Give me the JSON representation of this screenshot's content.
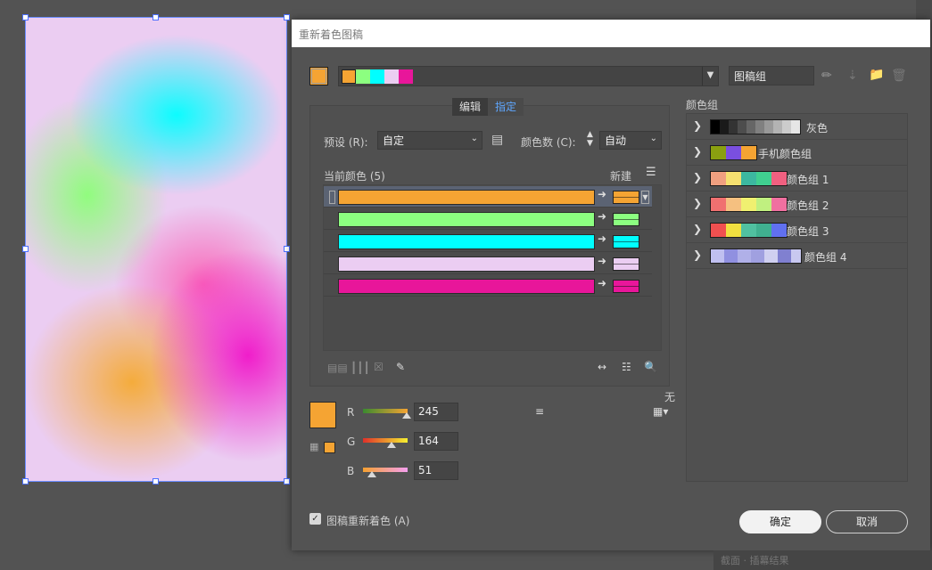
{
  "dialog": {
    "title": "重新着色图稿",
    "group_name": "图稿组",
    "tabs": [
      {
        "label": "编辑",
        "active": false
      },
      {
        "label": "指定",
        "active": true
      }
    ],
    "preset_label": "预设 (R):",
    "preset_value": "自定",
    "colors_label": "颜色数 (C):",
    "colors_value": "自动",
    "current_colors_label": "当前颜色 (5)",
    "new_label": "新建",
    "none_label": "无",
    "recolor_label": "图稿重新着色 (A)",
    "ok_label": "确定",
    "cancel_label": "取消"
  },
  "palette": [
    "#f5a433",
    "#8cff80",
    "#00ffff",
    "#ebcdf2",
    "#e8169a"
  ],
  "current_colors": [
    {
      "current": "#f5a433",
      "new": "#f5a433",
      "selected": true
    },
    {
      "current": "#8cff80",
      "new": "#8cff80",
      "selected": false
    },
    {
      "current": "#00ffff",
      "new": "#00ffff",
      "selected": false
    },
    {
      "current": "#ebcdf2",
      "new": "#ebcdf2",
      "selected": false
    },
    {
      "current": "#e8169a",
      "new": "#e8169a",
      "selected": false
    }
  ],
  "rgb": {
    "r_label": "R",
    "r_value": "245",
    "g_label": "G",
    "g_value": "164",
    "b_label": "B",
    "b_value": "51"
  },
  "color_groups": {
    "title": "颜色组",
    "groups": [
      {
        "name": "灰色",
        "swatches": [
          "#000000",
          "#1a1a1a",
          "#333333",
          "#4d4d4d",
          "#666666",
          "#808080",
          "#999999",
          "#b3b3b3",
          "#cccccc",
          "#e6e6e6"
        ]
      },
      {
        "name": "手机颜色组",
        "swatches": [
          "#8aa010",
          "#7a4fe0",
          "#f5a433"
        ]
      },
      {
        "name": "颜色组 1",
        "swatches": [
          "#f0a080",
          "#f5e070",
          "#3cb8a0",
          "#40d090",
          "#f06080"
        ]
      },
      {
        "name": "颜色组 2",
        "swatches": [
          "#f07070",
          "#f5c080",
          "#f0f070",
          "#c0f080",
          "#f070a0"
        ]
      },
      {
        "name": "颜色组 3",
        "swatches": [
          "#f05050",
          "#f0e040",
          "#50c0a0",
          "#40b090",
          "#6070f0"
        ]
      },
      {
        "name": "颜色组 4",
        "swatches": [
          "#c0c0f0",
          "#9090e0",
          "#b0b0e8",
          "#a0a0e0",
          "#d0d0f0",
          "#8080d0",
          "#c8c8f0"
        ]
      }
    ]
  },
  "bottom_strip_text": "截面 · 插幕结果"
}
